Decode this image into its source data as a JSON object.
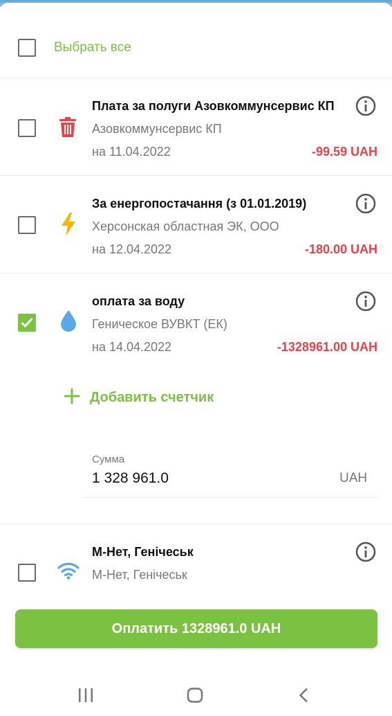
{
  "select_all": {
    "label": "Выбрать все",
    "checked": false
  },
  "services": [
    {
      "title": "Плата за полуги Азовкоммунсервис КП",
      "provider": "Азовкоммунсервис КП",
      "date": "на 11.04.2022",
      "amount": "-99.59 UAH",
      "icon": "trash-icon",
      "checked": false
    },
    {
      "title": "За енергопостачання (з 01.01.2019)",
      "provider": "Херсонская областная ЭК, ООО",
      "date": "на 12.04.2022",
      "amount": "-180.00 UAH",
      "icon": "lightning-icon",
      "checked": false
    },
    {
      "title": "оплата за воду",
      "provider": "Геническое ВУВКТ (ЕК)",
      "date": "на 14.04.2022",
      "amount": "-1328961.00 UAH",
      "icon": "water-drop-icon",
      "checked": true
    },
    {
      "title": "М-Нет, Генічеськ",
      "provider": "М-Нет, Генічеськ",
      "icon": "wifi-icon",
      "checked": false
    }
  ],
  "add_meter": {
    "label": "Добавить счетчик"
  },
  "sum": {
    "label": "Сумма",
    "value": "1 328 961.0",
    "currency": "UAH"
  },
  "pay_button": {
    "label": "Оплатить 1328961.0 UAH"
  },
  "colors": {
    "accent": "#7cc242",
    "negative": "#e8424a",
    "lightning": "#f5b800",
    "drop": "#5aa9e6"
  },
  "nav": {
    "icons": [
      "recent-apps-icon",
      "home-icon",
      "back-icon"
    ]
  }
}
